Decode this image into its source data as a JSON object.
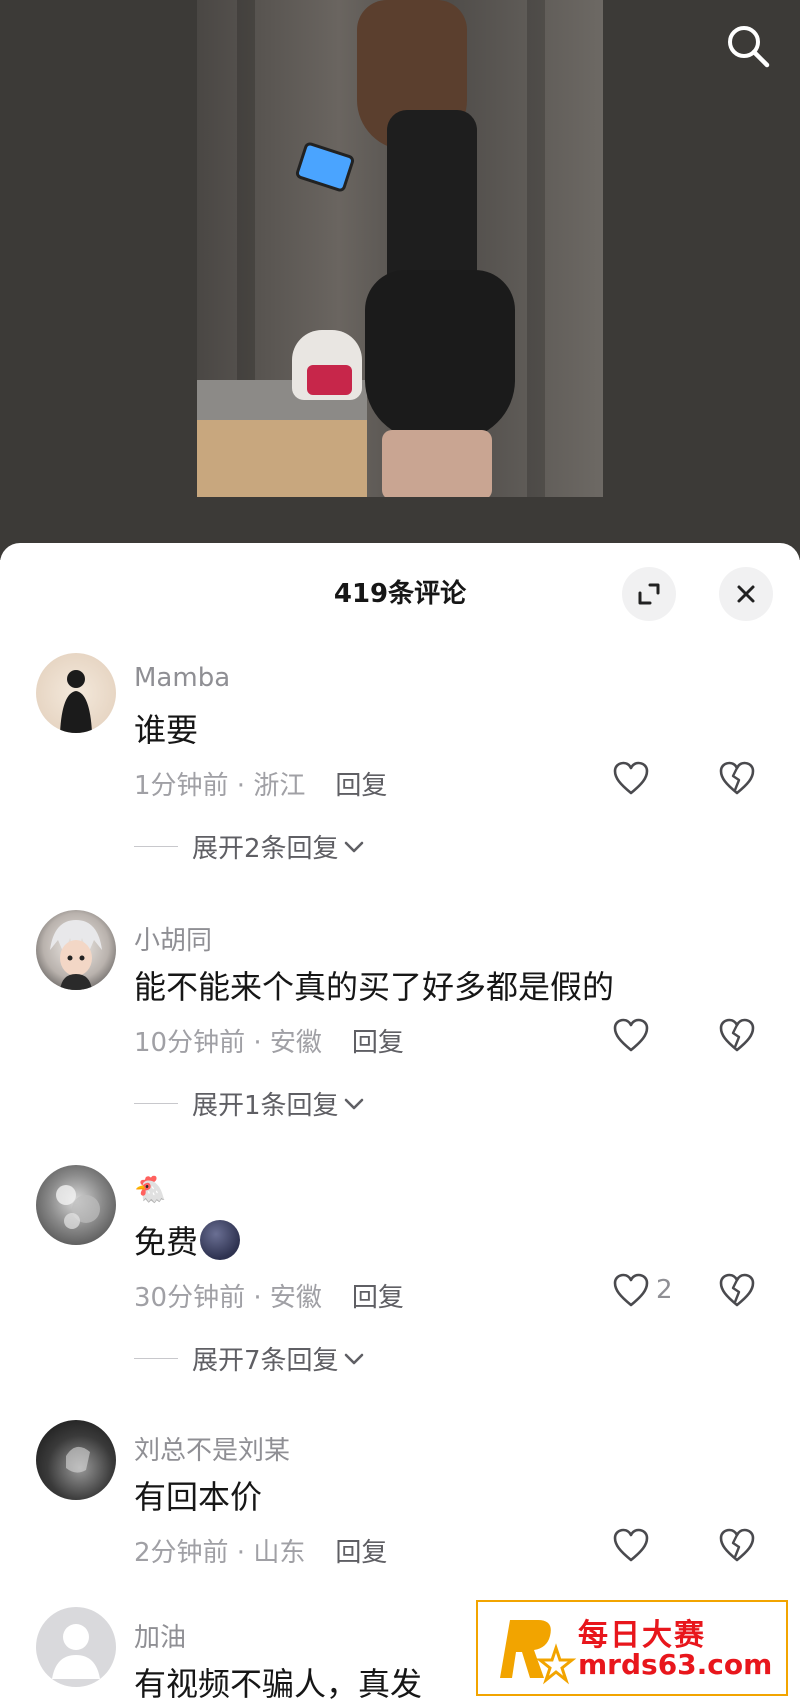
{
  "colors": {
    "accent_text": "#161616",
    "muted_text": "#8f8f94",
    "watermark_red": "#e8161c",
    "watermark_border": "#f2a400"
  },
  "comments_header": {
    "title": "419条评论",
    "expand_icon": "expand-icon",
    "close_icon": "close-icon"
  },
  "comments": [
    {
      "user": "Mamba",
      "text": "谁要",
      "time_location": "1分钟前 · 浙江",
      "reply_label": "回复",
      "likes": "",
      "expand_label": "展开2条回复"
    },
    {
      "user": "小胡同",
      "text": "能不能来个真的买了好多都是假的",
      "time_location": "10分钟前 · 安徽",
      "reply_label": "回复",
      "likes": "",
      "expand_label": "展开1条回复"
    },
    {
      "user": "🐔",
      "text": "免费",
      "time_location": "30分钟前 · 安徽",
      "reply_label": "回复",
      "likes": "2",
      "expand_label": "展开7条回复"
    },
    {
      "user": "刘总不是刘某",
      "text": "有回本价",
      "time_location": "2分钟前 · 山东",
      "reply_label": "回复",
      "likes": "",
      "expand_label": ""
    },
    {
      "user": "加油",
      "text": "有视频不骗人，真发",
      "time_location": "",
      "reply_label": "",
      "likes": "",
      "expand_label": ""
    }
  ],
  "watermark": {
    "name": "每日大赛",
    "url": "mrds63.com"
  }
}
